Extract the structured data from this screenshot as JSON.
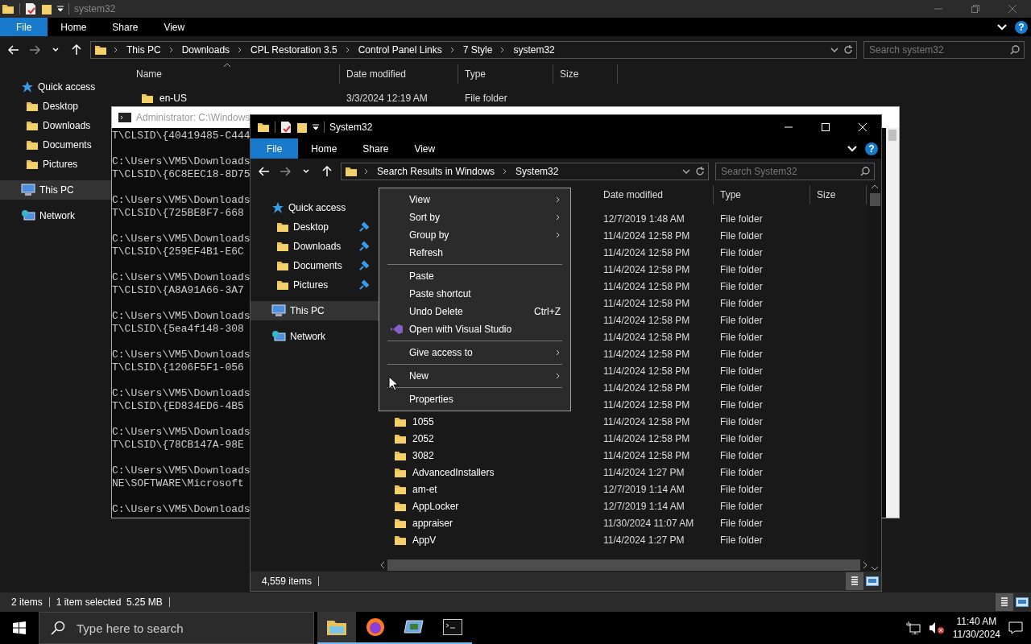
{
  "back_window": {
    "title": "system32",
    "file_tab": "File",
    "help": "?",
    "ribbon_tabs": [
      "Home",
      "Share",
      "View"
    ],
    "breadcrumb": [
      "This PC",
      "Downloads",
      "CPL Restoration 3.5",
      "Control Panel Links",
      "7 Style",
      "system32"
    ],
    "search": {
      "placeholder": "Search system32"
    },
    "nav": [
      {
        "label": "Quick access",
        "kind": "star",
        "selected": false,
        "children": [
          {
            "label": "Desktop",
            "kind": "folder",
            "selected": false
          },
          {
            "label": "Downloads",
            "kind": "folder",
            "selected": false
          },
          {
            "label": "Documents",
            "kind": "folder",
            "selected": false
          },
          {
            "label": "Pictures",
            "kind": "folder",
            "selected": false
          }
        ]
      },
      {
        "label": "This PC",
        "kind": "pc",
        "selected": true
      },
      {
        "label": "Network",
        "kind": "network",
        "selected": false
      }
    ],
    "columns": [
      "Name",
      "Date modified",
      "Type",
      "Size"
    ],
    "rows": [
      {
        "name": "en-US",
        "date": "3/3/2024 12:19 AM",
        "type": "File folder"
      }
    ],
    "status": [
      "2 items",
      "1 item selected  5.25 MB"
    ]
  },
  "cmd_window": {
    "title": "Administrator: C:\\Windows",
    "blocks": [
      [
        "T\\CLSID\\{40419485-C444"
      ],
      [
        "C:\\Users\\VM5\\Downloads",
        "T\\CLSID\\{6C8EEC18-8D75"
      ],
      [
        "C:\\Users\\VM5\\Downloads",
        "T\\CLSID\\{725BE8F7-668"
      ],
      [
        "C:\\Users\\VM5\\Downloads",
        "T\\CLSID\\{259EF4B1-E6C"
      ],
      [
        "C:\\Users\\VM5\\Downloads",
        "T\\CLSID\\{A8A91A66-3A7"
      ],
      [
        "C:\\Users\\VM5\\Downloads",
        "T\\CLSID\\{5ea4f148-308"
      ],
      [
        "C:\\Users\\VM5\\Downloads",
        "T\\CLSID\\{1206F5F1-056"
      ],
      [
        "C:\\Users\\VM5\\Downloads",
        "T\\CLSID\\{ED834ED6-4B5"
      ],
      [
        "C:\\Users\\VM5\\Downloads",
        "T\\CLSID\\{78CB147A-98E"
      ],
      [
        "C:\\Users\\VM5\\Downloads",
        "NE\\SOFTWARE\\Microsoft"
      ],
      [
        "C:\\Users\\VM5\\Downloads"
      ]
    ]
  },
  "front_window": {
    "title": "System32",
    "file_tab": "File",
    "help": "?",
    "ribbon_tabs": [
      "Home",
      "Share",
      "View"
    ],
    "breadcrumb": [
      "Search Results in Windows",
      "System32"
    ],
    "search": {
      "placeholder": "Search System32"
    },
    "nav": [
      {
        "label": "Quick access",
        "kind": "star",
        "selected": false,
        "children": [
          {
            "label": "Desktop",
            "kind": "folder",
            "selected": false,
            "pinned": true
          },
          {
            "label": "Downloads",
            "kind": "folder",
            "selected": false,
            "pinned": true
          },
          {
            "label": "Documents",
            "kind": "folder",
            "selected": false,
            "pinned": true
          },
          {
            "label": "Pictures",
            "kind": "folder",
            "selected": false,
            "pinned": true
          }
        ]
      },
      {
        "label": "This PC",
        "kind": "pc",
        "selected": true
      },
      {
        "label": "Network",
        "kind": "network",
        "selected": false
      }
    ],
    "columns": [
      "Date modified",
      "Type",
      "Size"
    ],
    "rows": [
      {
        "date": "12/7/2019 1:48 AM",
        "type": "File folder"
      },
      {
        "date": "11/4/2024 12:58 PM",
        "type": "File folder"
      },
      {
        "date": "11/4/2024 12:58 PM",
        "type": "File folder"
      },
      {
        "date": "11/4/2024 12:58 PM",
        "type": "File folder"
      },
      {
        "date": "11/4/2024 12:58 PM",
        "type": "File folder"
      },
      {
        "date": "11/4/2024 12:58 PM",
        "type": "File folder"
      },
      {
        "date": "11/4/2024 12:58 PM",
        "type": "File folder"
      },
      {
        "date": "11/4/2024 12:58 PM",
        "type": "File folder"
      },
      {
        "date": "11/4/2024 12:58 PM",
        "type": "File folder"
      },
      {
        "date": "11/4/2024 12:58 PM",
        "type": "File folder"
      },
      {
        "date": "11/4/2024 12:58 PM",
        "type": "File folder"
      },
      {
        "date": "11/4/2024 12:58 PM",
        "type": "File folder"
      },
      {
        "name": "1055",
        "date": "11/4/2024 12:58 PM",
        "type": "File folder"
      },
      {
        "name": "2052",
        "date": "11/4/2024 12:58 PM",
        "type": "File folder"
      },
      {
        "name": "3082",
        "date": "11/4/2024 12:58 PM",
        "type": "File folder"
      },
      {
        "name": "AdvancedInstallers",
        "date": "11/4/2024 1:27 PM",
        "type": "File folder"
      },
      {
        "name": "am-et",
        "date": "12/7/2019 1:14 AM",
        "type": "File folder"
      },
      {
        "name": "AppLocker",
        "date": "12/7/2019 1:14 AM",
        "type": "File folder"
      },
      {
        "name": "appraiser",
        "date": "11/30/2024 11:07 AM",
        "type": "File folder"
      },
      {
        "name": "AppV",
        "date": "11/4/2024 1:27 PM",
        "type": "File folder"
      }
    ],
    "status": [
      "4,559 items"
    ]
  },
  "context_menu": {
    "groups": [
      [
        {
          "label": "View",
          "kind": "plain",
          "submenu": true
        },
        {
          "label": "Sort by",
          "kind": "plain",
          "submenu": true
        },
        {
          "label": "Group by",
          "kind": "plain",
          "submenu": true
        },
        {
          "label": "Refresh",
          "kind": "plain",
          "submenu": false
        }
      ],
      [
        {
          "label": "Paste",
          "kind": "plain",
          "submenu": false
        },
        {
          "label": "Paste shortcut",
          "kind": "plain",
          "submenu": false
        },
        {
          "label": "Undo Delete",
          "kind": "plain",
          "submenu": false,
          "shortcut": "Ctrl+Z"
        },
        {
          "label": "Open with Visual Studio",
          "kind": "app",
          "submenu": false
        }
      ],
      [
        {
          "label": "Give access to",
          "kind": "plain",
          "submenu": true
        }
      ],
      [
        {
          "label": "New",
          "kind": "plain",
          "submenu": true
        }
      ],
      [
        {
          "label": "Properties",
          "kind": "plain",
          "submenu": false
        }
      ]
    ]
  },
  "taskbar": {
    "search": {
      "placeholder": "Type here to search"
    },
    "apps": [
      {
        "kind": "explorer",
        "active": true
      },
      {
        "kind": "firefox",
        "active": false
      },
      {
        "kind": "remote",
        "active": false
      },
      {
        "kind": "console",
        "active": false
      }
    ],
    "time": "11:40 AM",
    "date": "11/30/2024"
  }
}
